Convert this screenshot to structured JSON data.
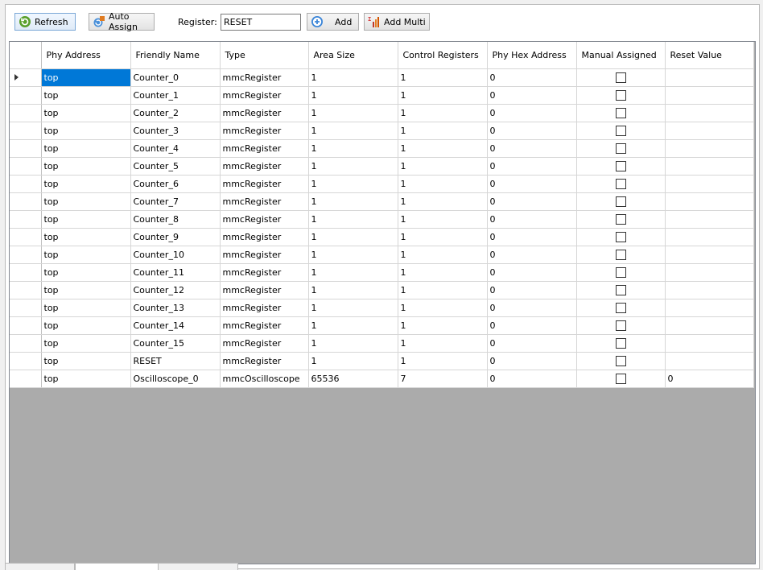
{
  "toolbar": {
    "refresh_label": "Refresh",
    "auto_assign_label": "Auto Assign",
    "register_label": "Register:",
    "register_value": "RESET",
    "add_label": "Add",
    "add_multi_label": "Add Multi"
  },
  "table": {
    "columns": [
      "Phy Address",
      "Friendly Name",
      "Type",
      "Area Size",
      "Control Registers",
      "Phy Hex Address",
      "Manual Assigned",
      "Reset Value"
    ],
    "rows": [
      {
        "phy": "top",
        "name": "Counter_0",
        "type": "mmcRegister",
        "area": "1",
        "ctrl": "1",
        "hex": "0",
        "reset": ""
      },
      {
        "phy": "top",
        "name": "Counter_1",
        "type": "mmcRegister",
        "area": "1",
        "ctrl": "1",
        "hex": "0",
        "reset": ""
      },
      {
        "phy": "top",
        "name": "Counter_2",
        "type": "mmcRegister",
        "area": "1",
        "ctrl": "1",
        "hex": "0",
        "reset": ""
      },
      {
        "phy": "top",
        "name": "Counter_3",
        "type": "mmcRegister",
        "area": "1",
        "ctrl": "1",
        "hex": "0",
        "reset": ""
      },
      {
        "phy": "top",
        "name": "Counter_4",
        "type": "mmcRegister",
        "area": "1",
        "ctrl": "1",
        "hex": "0",
        "reset": ""
      },
      {
        "phy": "top",
        "name": "Counter_5",
        "type": "mmcRegister",
        "area": "1",
        "ctrl": "1",
        "hex": "0",
        "reset": ""
      },
      {
        "phy": "top",
        "name": "Counter_6",
        "type": "mmcRegister",
        "area": "1",
        "ctrl": "1",
        "hex": "0",
        "reset": ""
      },
      {
        "phy": "top",
        "name": "Counter_7",
        "type": "mmcRegister",
        "area": "1",
        "ctrl": "1",
        "hex": "0",
        "reset": ""
      },
      {
        "phy": "top",
        "name": "Counter_8",
        "type": "mmcRegister",
        "area": "1",
        "ctrl": "1",
        "hex": "0",
        "reset": ""
      },
      {
        "phy": "top",
        "name": "Counter_9",
        "type": "mmcRegister",
        "area": "1",
        "ctrl": "1",
        "hex": "0",
        "reset": ""
      },
      {
        "phy": "top",
        "name": "Counter_10",
        "type": "mmcRegister",
        "area": "1",
        "ctrl": "1",
        "hex": "0",
        "reset": ""
      },
      {
        "phy": "top",
        "name": "Counter_11",
        "type": "mmcRegister",
        "area": "1",
        "ctrl": "1",
        "hex": "0",
        "reset": ""
      },
      {
        "phy": "top",
        "name": "Counter_12",
        "type": "mmcRegister",
        "area": "1",
        "ctrl": "1",
        "hex": "0",
        "reset": ""
      },
      {
        "phy": "top",
        "name": "Counter_13",
        "type": "mmcRegister",
        "area": "1",
        "ctrl": "1",
        "hex": "0",
        "reset": ""
      },
      {
        "phy": "top",
        "name": "Counter_14",
        "type": "mmcRegister",
        "area": "1",
        "ctrl": "1",
        "hex": "0",
        "reset": ""
      },
      {
        "phy": "top",
        "name": "Counter_15",
        "type": "mmcRegister",
        "area": "1",
        "ctrl": "1",
        "hex": "0",
        "reset": ""
      },
      {
        "phy": "top",
        "name": "RESET",
        "type": "mmcRegister",
        "area": "1",
        "ctrl": "1",
        "hex": "0",
        "reset": ""
      },
      {
        "phy": "top",
        "name": "Oscilloscope_0",
        "type": "mmcOscilloscope",
        "area": "65536",
        "ctrl": "7",
        "hex": "0",
        "reset": "0"
      }
    ]
  },
  "icons": {
    "refresh": "refresh-icon",
    "auto_assign": "auto-assign-icon",
    "add": "add-circle-icon",
    "add_multi": "add-multi-icon"
  }
}
